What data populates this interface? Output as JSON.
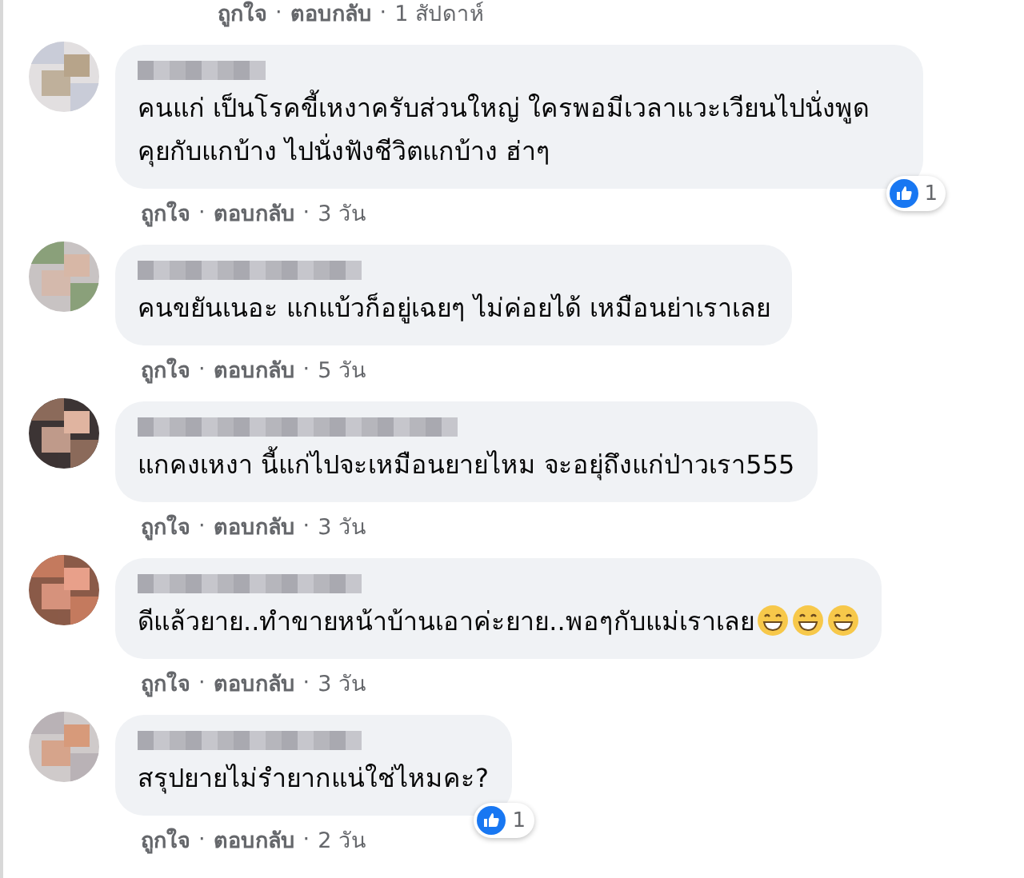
{
  "top_footer": {
    "like": "ถูกใจ",
    "sep1": "·",
    "reply": "ตอบกลับ",
    "sep2": "·",
    "time": "1 สัปดาห์"
  },
  "comments": [
    {
      "text": "คนแก่ เป็นโรคขี้เหงาครับส่วนใหญ่ ใครพอมีเวลาแวะเวียนไปนั่งพูดคุยกับแกบ้าง ไปนั่งฟังชีวิตแกบ้าง ฮ่าๆ",
      "reaction_count": "1",
      "like": "ถูกใจ",
      "sep1": "·",
      "reply": "ตอบกลับ",
      "sep2": "·",
      "time": "3 วัน"
    },
    {
      "text": "คนขยันเนอะ แกแบ้วก็อยู่เฉยๆ ไม่ค่อยได้ เหมือนย่าเราเลย",
      "like": "ถูกใจ",
      "sep1": "·",
      "reply": "ตอบกลับ",
      "sep2": "·",
      "time": "5 วัน"
    },
    {
      "text": "แกคงเหงา นี้แก่ไปจะเหมือนยายไหม จะอยุ่ถึงแก่ป่าวเรา555",
      "like": "ถูกใจ",
      "sep1": "·",
      "reply": "ตอบกลับ",
      "sep2": "·",
      "time": "3 วัน"
    },
    {
      "text": "ดีแล้วยาย..ทำขายหน้าบ้านเอาค่ะยาย..พอๆกับแม่เราเลย",
      "icons": [
        {
          "kind": "grin"
        },
        {
          "kind": "grin"
        },
        {
          "kind": "grin"
        }
      ],
      "like": "ถูกใจ",
      "sep1": "·",
      "reply": "ตอบกลับ",
      "sep2": "·",
      "time": "3 วัน"
    },
    {
      "text": "สรุปยายไม่รำยากแน่ใช่ไหมคะ?",
      "reaction_count": "1",
      "like": "ถูกใจ",
      "sep1": "·",
      "reply": "ตอบกลับ",
      "sep2": "·",
      "time": "2 วัน"
    }
  ]
}
